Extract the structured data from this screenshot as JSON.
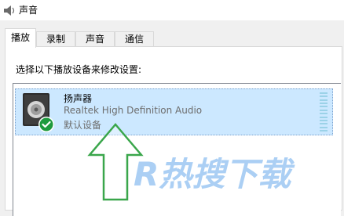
{
  "window": {
    "title": "声音"
  },
  "tabs": [
    {
      "label": "播放",
      "active": true
    },
    {
      "label": "录制",
      "active": false
    },
    {
      "label": "声音",
      "active": false
    },
    {
      "label": "通信",
      "active": false
    }
  ],
  "panel": {
    "instruction": "选择以下播放设备来修改设置:"
  },
  "devices": [
    {
      "name": "扬声器",
      "description": "Realtek High Definition Audio",
      "status": "默认设备",
      "icon": "speaker-icon",
      "badge": "default-checkmark-icon",
      "selected": true
    }
  ],
  "overlays": {
    "arrow_icon": "up-arrow-icon",
    "arrow_color": "#3aa64b",
    "watermark": "R热搜下载"
  },
  "colors": {
    "selection": "#cce8ff",
    "meter": "#9bd2e8",
    "badge": "#1e9a3e"
  }
}
